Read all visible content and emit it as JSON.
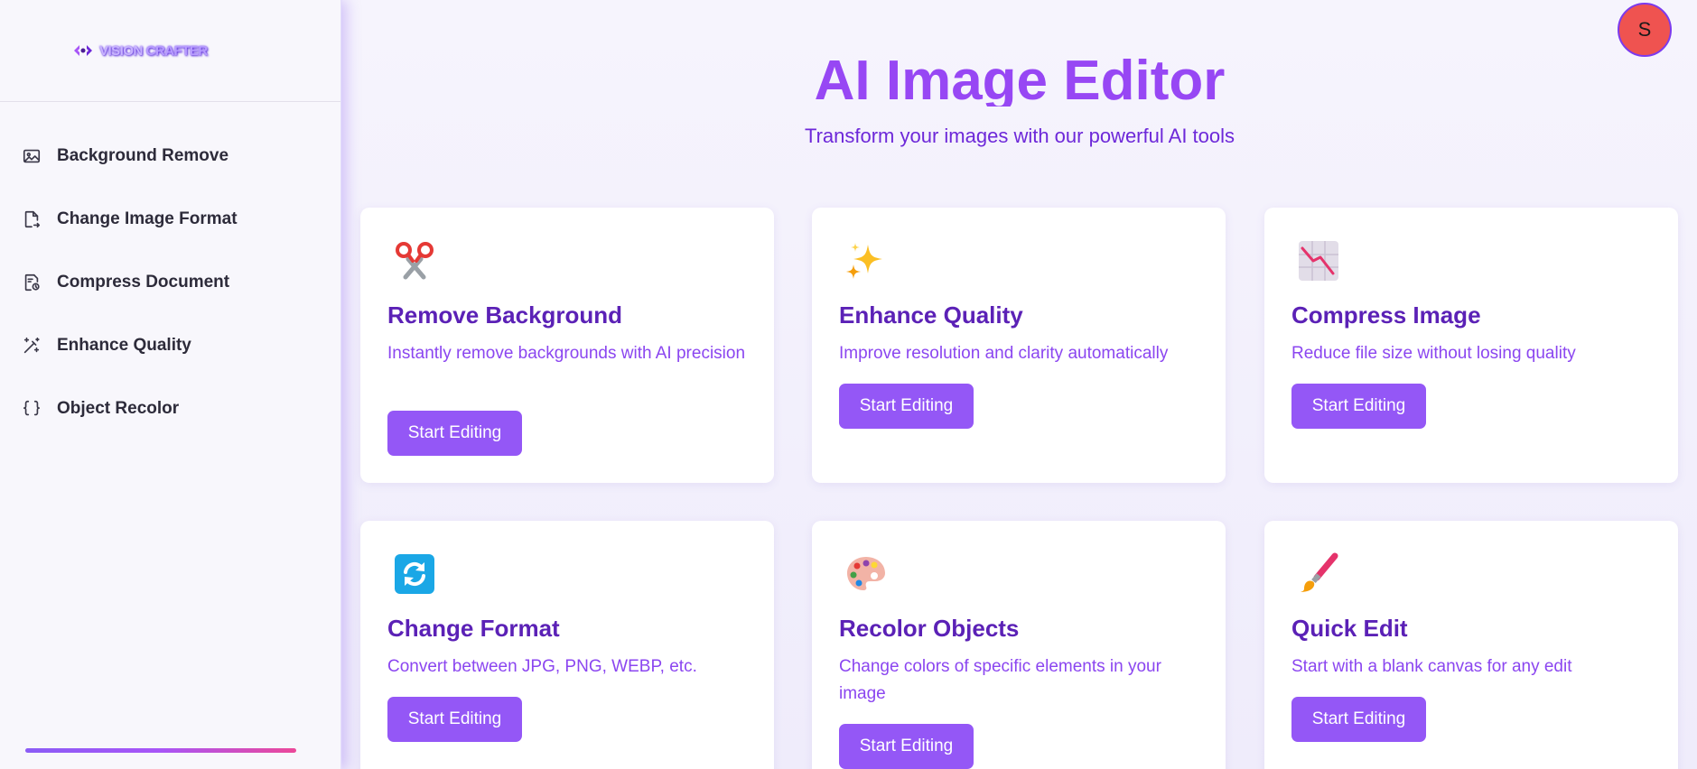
{
  "brand": {
    "logo_part1": "VISION",
    "logo_part2": "CRAFTER"
  },
  "sidebar": {
    "items": [
      {
        "label": "Background Remove",
        "icon": "image-icon"
      },
      {
        "label": "Change Image Format",
        "icon": "file-convert-icon"
      },
      {
        "label": "Compress Document",
        "icon": "file-compress-icon"
      },
      {
        "label": "Enhance Quality",
        "icon": "magic-wand-icon"
      },
      {
        "label": "Object Recolor",
        "icon": "braces-icon"
      }
    ]
  },
  "header": {
    "avatar_initial": "S",
    "title": "AI Image Editor",
    "subtitle": "Transform your images with our powerful AI tools"
  },
  "cards": [
    {
      "title": "Remove Background",
      "desc": "Instantly remove backgrounds with AI precision",
      "button": "Start Editing",
      "icon": "scissors-icon"
    },
    {
      "title": "Enhance Quality",
      "desc": "Improve resolution and clarity automatically",
      "button": "Start Editing",
      "icon": "sparkles-icon"
    },
    {
      "title": "Compress Image",
      "desc": "Reduce file size without losing quality",
      "button": "Start Editing",
      "icon": "chart-decreasing-icon"
    },
    {
      "title": "Change Format",
      "desc": "Convert between JPG, PNG, WEBP, etc.",
      "button": "Start Editing",
      "icon": "refresh-icon"
    },
    {
      "title": "Recolor Objects",
      "desc": "Change colors of specific elements in your image",
      "button": "Start Editing",
      "icon": "palette-icon"
    },
    {
      "title": "Quick Edit",
      "desc": "Start with a blank canvas for any edit",
      "button": "Start Editing",
      "icon": "paintbrush-icon"
    }
  ],
  "colors": {
    "accent": "#9457f6",
    "title": "#9747f4",
    "card_title": "#5b21b6",
    "avatar_bg": "#ef5350"
  }
}
